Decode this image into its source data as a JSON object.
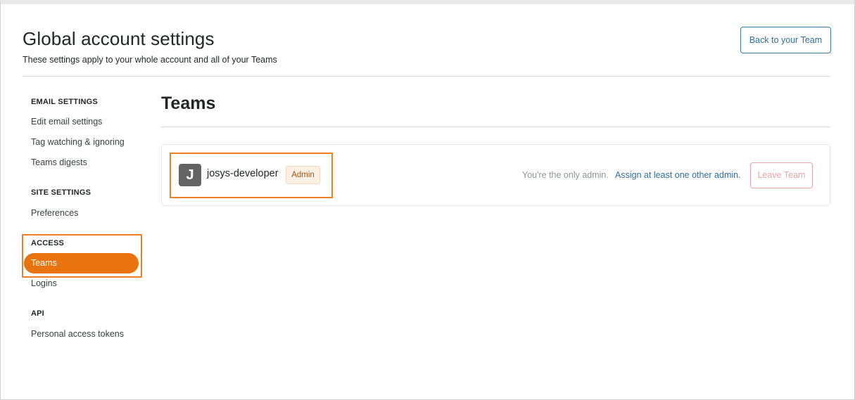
{
  "header": {
    "title": "Global account settings",
    "subtitle": "These settings apply to your whole account and all of your Teams",
    "back_button": "Back to your Team"
  },
  "sidebar": {
    "sections": [
      {
        "heading": "EMAIL SETTINGS",
        "items": [
          "Edit email settings",
          "Tag watching & ignoring",
          "Teams digests"
        ]
      },
      {
        "heading": "SITE SETTINGS",
        "items": [
          "Preferences"
        ]
      },
      {
        "heading": "ACCESS",
        "items": [
          "Teams",
          "Logins"
        ]
      },
      {
        "heading": "API",
        "items": [
          "Personal access tokens"
        ]
      }
    ],
    "active_item": "Teams"
  },
  "main": {
    "section_title": "Teams",
    "team": {
      "avatar_letter": "J",
      "name": "josys-developer",
      "role_badge": "Admin",
      "admin_note": "You're the only admin.",
      "assign_link": "Assign at least one other admin.",
      "leave_button": "Leave Team"
    }
  },
  "colors": {
    "accent": "#e8730f",
    "highlight_border": "#f07f23",
    "link": "#2f6f9e",
    "leave_button": "#e8a4a4",
    "avatar_bg": "#636363"
  }
}
